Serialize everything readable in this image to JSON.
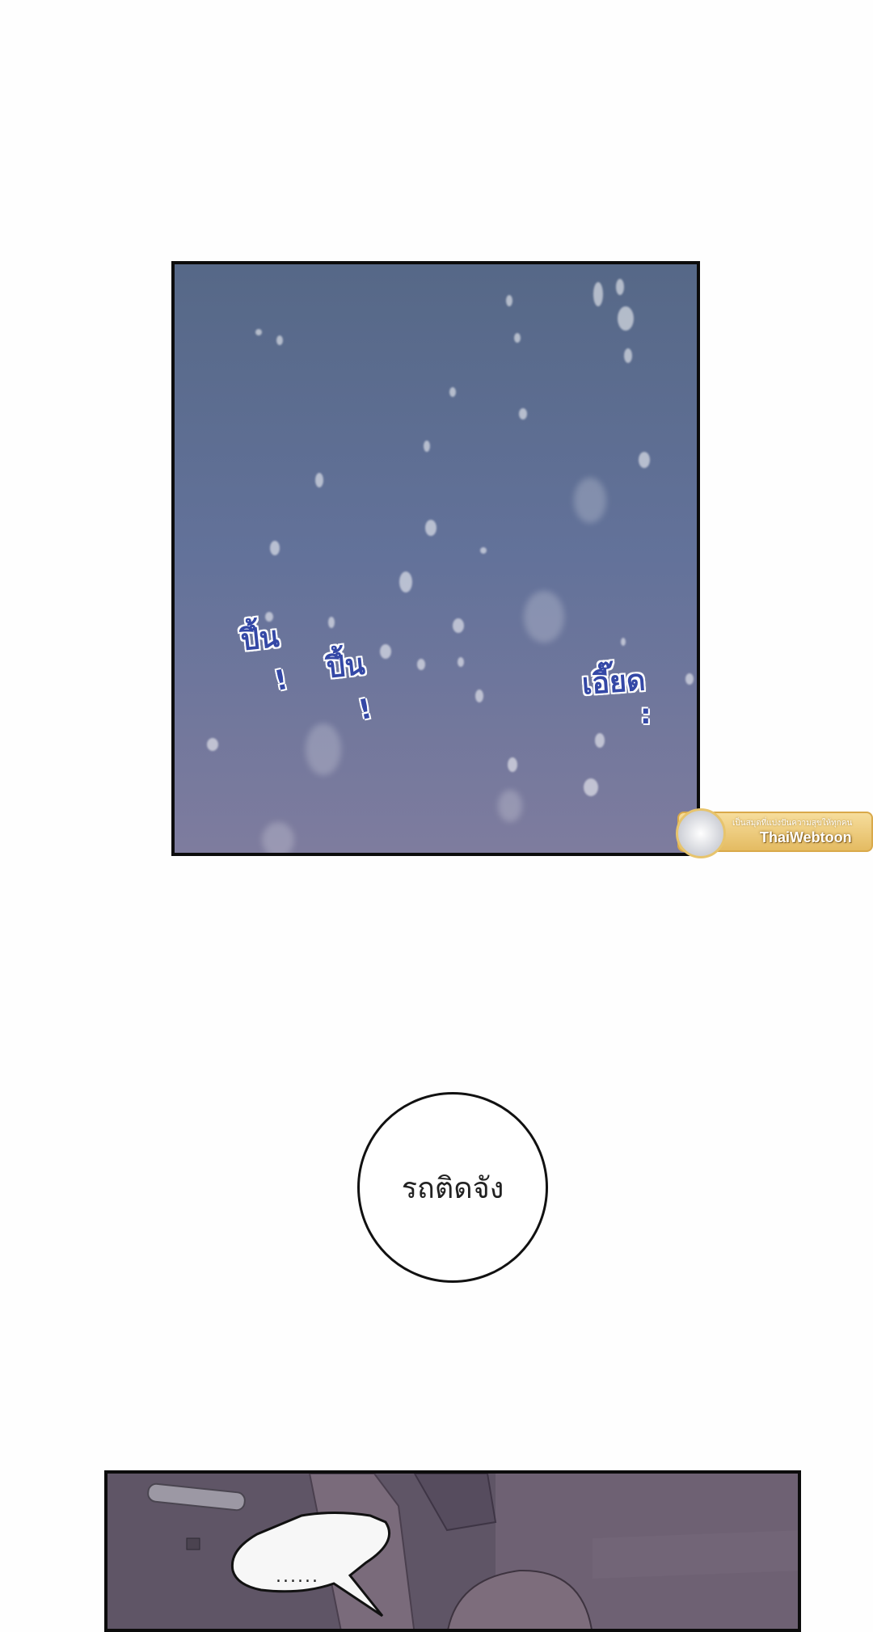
{
  "panel_1": {
    "sfx_left": "ปึ้น",
    "sfx_left_mark": "!",
    "sfx_middle": "ปึ้น",
    "sfx_middle_mark": "!",
    "sfx_right": "เอี๊ยด",
    "sfx_right_mark": ":"
  },
  "watermark": {
    "tagline": "เป็นสมุดที่แบ่งปันความสุขให้ทุกคน",
    "name": "ThaiWebtoon"
  },
  "speech_bubble": {
    "text": "รถติดจัง"
  },
  "panel_2": {
    "bubble_text": "......"
  },
  "colors": {
    "sfx": "#3448a6",
    "sky_top": "#566887",
    "sky_bottom": "#7e7c9e",
    "car_interior": "#5e5466"
  }
}
